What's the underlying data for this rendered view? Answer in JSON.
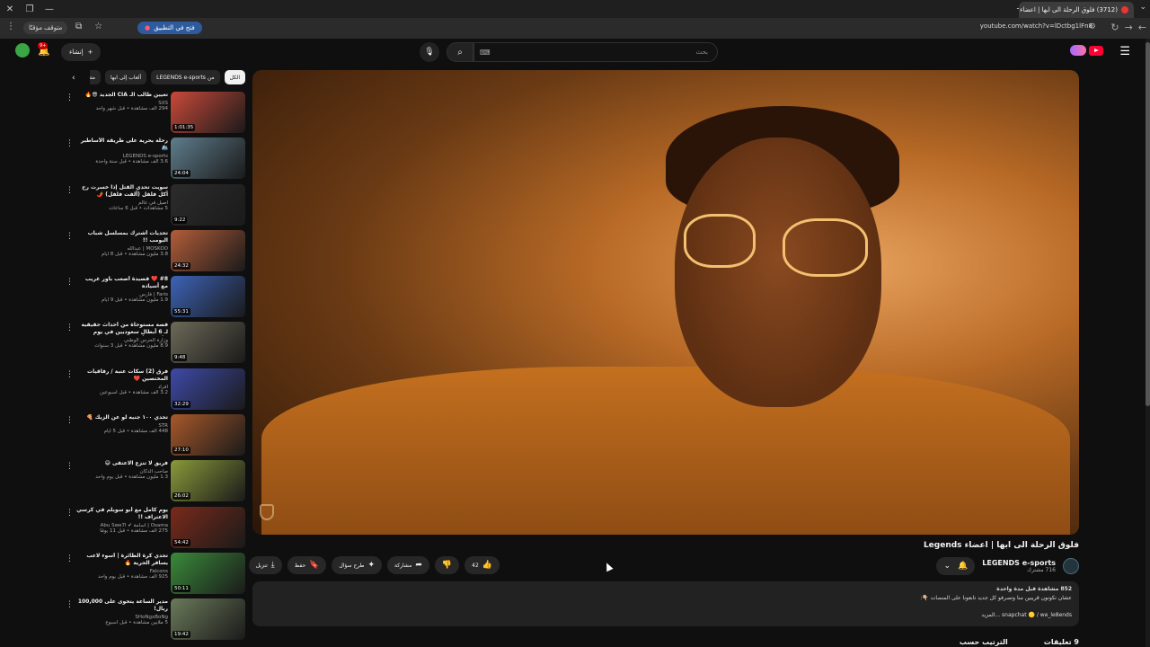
{
  "browser": {
    "tab_title": "(3712) فلوق الرحلة الى ابها | اعضاء",
    "url": "youtube.com/watch?v=lDctbg1lFn8",
    "open_in_app": "فتح في التطبيق",
    "paused_label": "متوقف مؤقتًا"
  },
  "header": {
    "search_placeholder": "بحث",
    "create_label": "إنشاء",
    "notif_count": "9+"
  },
  "video": {
    "title": "فلوق الرحلة الى ابها | اعضاء Legends",
    "channel": "LEGENDS e-sports",
    "subscribers": "716 مشترك",
    "likes": "42",
    "share": "مشاركة",
    "ask": "طرح سؤال",
    "save": "حفظ",
    "download": "تنزيل",
    "description": {
      "stats": "852 مشاهدة  قبل مدة واحدة",
      "line2": "عشان تكونون قريبين منا وتصرفو كل جديد تابعونا على المنصات 👇🏼:",
      "line3": "snapchat 🟡 / we_le8ends  ...المزيد"
    },
    "comments": "9 تعليقات",
    "sort": "الترتيب حسب"
  },
  "chips": [
    "الكل",
    "من LEGENDS e-sports",
    "ألعاب إلى ابها",
    "متعلّق"
  ],
  "recommendations": [
    {
      "title": "تعيين طالب الـ CIA الجديد 😎🔥",
      "channel": "SXS",
      "meta": "294 ألف مشاهدة • قبل شهر واحد",
      "duration": "1:01:35",
      "color": "#c9493a"
    },
    {
      "title": "رحلة بحرية على طريقة الأساطير 🛳️",
      "channel": "LEGENDS e-sports",
      "meta": "3.6 ألف مشاهدة • قبل سنة واحدة",
      "duration": "24:04",
      "color": "#5f7d8c"
    },
    {
      "title": "سويت تحدي القتل إذا خسرت رح آكل فلفل (ألفت فلفل) 🌶️",
      "channel": "أصيل في عالم",
      "meta": "5 مشاهدات • قبل 6 ساعات",
      "duration": "9:22",
      "color": "#2c2c2c"
    },
    {
      "title": "تحديات أشترك بمسلسل شباب البومب !!",
      "channel": "MOSKOO | عبدالله",
      "meta": "3.8 مليون مشاهدة • قبل 8 أيام",
      "duration": "24:32",
      "color": "#b35d3a"
    },
    {
      "title": "#8 ❤️ قصيدة أصعب باور غريب مع أسياده",
      "channel": "Faris | فارس",
      "meta": "1.9 مليون مشاهدة • قبل 9 أيام",
      "duration": "55:31",
      "color": "#3d63b8"
    },
    {
      "title": "قصة مستوحاة من أحداث حقيقية لـ 6 أبطال سعوديين في يوم الأجزاء الأخيرة",
      "channel": "وزارة الحرس الوطني",
      "meta": "8.9 مليون مشاهدة • قبل 3 سنوات",
      "duration": "9:48",
      "color": "#6d6a58"
    },
    {
      "title": "فرق (2) سكات عتبة / رفاقيات المختصين ❤️",
      "channel": "أفراد",
      "meta": "3.2 ألف مشاهدة • قبل أسبوعين",
      "duration": "32:29",
      "color": "#3e4aa8"
    },
    {
      "title": "تحدي ١٠٠ جنيه لو عن الزيك 🍕",
      "channel": "STR",
      "meta": "448 ألف مشاهدة • قبل 5 أيام",
      "duration": "27:10",
      "color": "#a8582a"
    },
    {
      "title": "فريق لا تنزع الاعتقى 😅",
      "channel": "صاحب الدكان",
      "meta": "1.3 مليون مشاهدة • قبل يوم واحد",
      "duration": "26:02",
      "color": "#8a9a3a"
    },
    {
      "title": "يوم كامل مع أبو سويلم في كرسي الاعتراف !!",
      "channel": "Osama | أسامة ✔ Abu Swe7l",
      "meta": "275 ألف مشاهدة • قبل 11 يومًا",
      "duration": "54:42",
      "color": "#7a2a1a"
    },
    {
      "title": "تحدي كرة الطائرة | أسوء لاعب يسافر الحرية 🔥",
      "channel": "Falcons",
      "meta": "925 ألف مشاهدة • قبل يوم واحد",
      "duration": "50:11",
      "color": "#3a8a3a"
    },
    {
      "title": "مدير الساعة يتخوى على 100,000 ريال!",
      "channel": "SHoNgxBoNg",
      "meta": "5 ملايين مشاهدة • قبل أسبوع",
      "duration": "19:42",
      "color": "#6a7a5a"
    }
  ]
}
